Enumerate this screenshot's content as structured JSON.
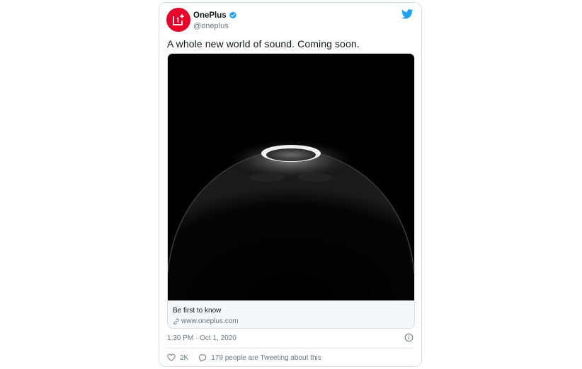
{
  "author": {
    "name": "OnePlus",
    "handle": "@oneplus",
    "verified": true,
    "avatar_color": "#eb0029"
  },
  "tweet": {
    "text": "A whole new world of sound. Coming soon.",
    "timestamp": "1:30 PM · Oct 1, 2020"
  },
  "card": {
    "title": "Be first to know",
    "domain": "www.oneplus.com",
    "link_icon": "link-icon"
  },
  "actions": {
    "likes": "2K",
    "conversation": "179 people are Tweeting about this"
  },
  "icons": {
    "brand": "twitter-bird-icon",
    "verified": "verified-badge-icon",
    "info": "info-icon",
    "like": "heart-icon",
    "reply": "speech-bubble-icon"
  },
  "colors": {
    "accent": "#1da1f2",
    "brand_red": "#eb0029",
    "muted_text": "#657786"
  }
}
